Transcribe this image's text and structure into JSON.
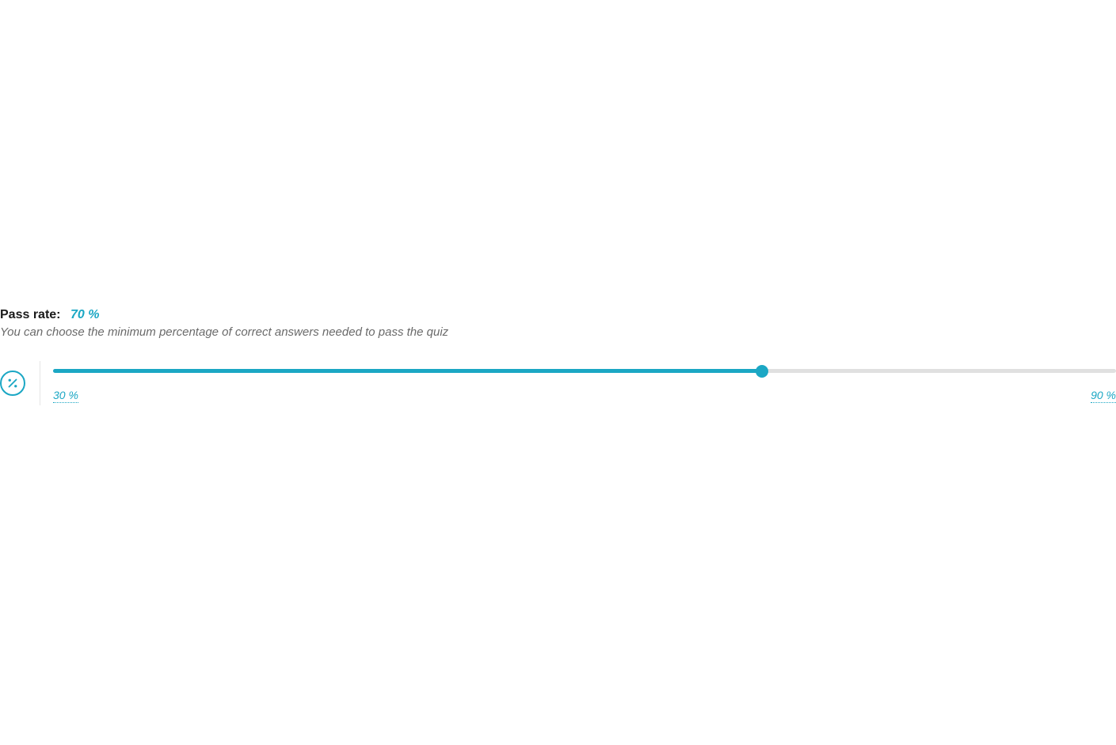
{
  "passRate": {
    "label": "Pass rate:",
    "value": "70 %",
    "description": "You can choose the minimum percentage of correct answers needed to pass the quiz",
    "slider": {
      "min": 30,
      "max": 90,
      "current": 70,
      "minLabel": "30 %",
      "maxLabel": "90 %"
    }
  },
  "colors": {
    "accent": "#1ba7c4"
  }
}
